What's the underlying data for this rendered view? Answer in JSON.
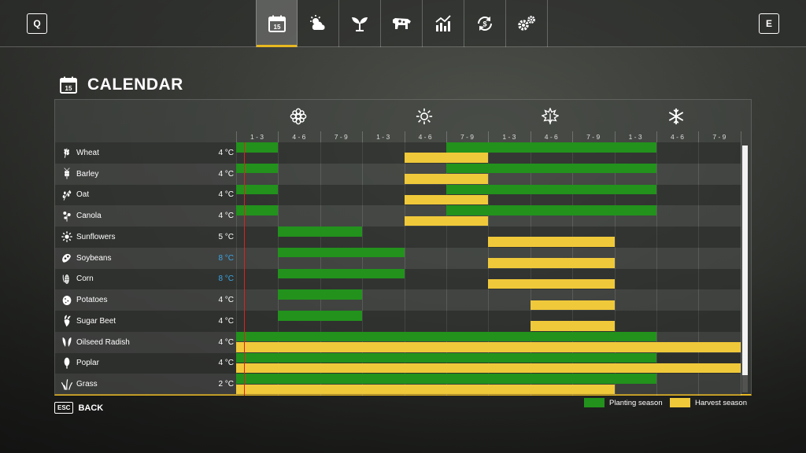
{
  "topbar": {
    "left_key": "Q",
    "right_key": "E",
    "tabs": [
      {
        "icon": "calendar-icon",
        "day": "15",
        "active": true
      },
      {
        "icon": "weather-icon",
        "active": false
      },
      {
        "icon": "sprout-icon",
        "active": false
      },
      {
        "icon": "cow-icon",
        "active": false
      },
      {
        "icon": "prices-chart-icon",
        "active": false
      },
      {
        "icon": "contracts-icon",
        "active": false
      },
      {
        "icon": "settings-gears-icon",
        "active": false
      }
    ]
  },
  "page": {
    "title": "CALENDAR",
    "icon": "calendar-icon",
    "icon_day": "15"
  },
  "seasons": [
    {
      "name": "spring",
      "icon": "flower-icon"
    },
    {
      "name": "summer",
      "icon": "sun-icon"
    },
    {
      "name": "autumn",
      "icon": "leaf-icon"
    },
    {
      "name": "winter",
      "icon": "snowflake-icon"
    }
  ],
  "month_labels": [
    "1 - 3",
    "4 - 6",
    "7 - 9",
    "1 - 3",
    "4 - 6",
    "7 - 9",
    "1 - 3",
    "4 - 6",
    "7 - 9",
    "1 - 3",
    "4 - 6",
    "7 - 9"
  ],
  "crops": [
    {
      "name": "Wheat",
      "temp": "4 °C",
      "warm": false,
      "icon": "wheat-icon",
      "plant": [
        [
          0,
          1
        ],
        [
          5,
          10
        ]
      ],
      "harvest": [
        [
          4,
          6
        ]
      ]
    },
    {
      "name": "Barley",
      "temp": "4 °C",
      "warm": false,
      "icon": "barley-icon",
      "plant": [
        [
          0,
          1
        ],
        [
          5,
          10
        ]
      ],
      "harvest": [
        [
          4,
          6
        ]
      ]
    },
    {
      "name": "Oat",
      "temp": "4 °C",
      "warm": false,
      "icon": "oat-icon",
      "plant": [
        [
          0,
          1
        ],
        [
          5,
          10
        ]
      ],
      "harvest": [
        [
          4,
          6
        ]
      ]
    },
    {
      "name": "Canola",
      "temp": "4 °C",
      "warm": false,
      "icon": "canola-icon",
      "plant": [
        [
          0,
          1
        ],
        [
          5,
          10
        ]
      ],
      "harvest": [
        [
          4,
          6
        ]
      ]
    },
    {
      "name": "Sunflowers",
      "temp": "5 °C",
      "warm": false,
      "icon": "sunflower-icon",
      "plant": [
        [
          1,
          3
        ]
      ],
      "harvest": [
        [
          6,
          9
        ]
      ]
    },
    {
      "name": "Soybeans",
      "temp": "8 °C",
      "warm": true,
      "icon": "soybean-icon",
      "plant": [
        [
          1,
          4
        ]
      ],
      "harvest": [
        [
          6,
          9
        ]
      ]
    },
    {
      "name": "Corn",
      "temp": "8 °C",
      "warm": true,
      "icon": "corn-icon",
      "plant": [
        [
          1,
          4
        ]
      ],
      "harvest": [
        [
          6,
          9
        ]
      ]
    },
    {
      "name": "Potatoes",
      "temp": "4 °C",
      "warm": false,
      "icon": "potato-icon",
      "plant": [
        [
          1,
          3
        ]
      ],
      "harvest": [
        [
          7,
          9
        ]
      ]
    },
    {
      "name": "Sugar Beet",
      "temp": "4 °C",
      "warm": false,
      "icon": "sugar-beet-icon",
      "plant": [
        [
          1,
          3
        ]
      ],
      "harvest": [
        [
          7,
          9
        ]
      ]
    },
    {
      "name": "Oilseed Radish",
      "temp": "4 °C",
      "warm": false,
      "icon": "oilseed-radish-icon",
      "plant": [
        [
          0,
          10
        ]
      ],
      "harvest": [
        [
          0,
          12
        ]
      ]
    },
    {
      "name": "Poplar",
      "temp": "4 °C",
      "warm": false,
      "icon": "poplar-icon",
      "plant": [
        [
          0,
          10
        ]
      ],
      "harvest": [
        [
          0,
          12
        ]
      ]
    },
    {
      "name": "Grass",
      "temp": "2 °C",
      "warm": false,
      "icon": "grass-icon",
      "plant": [
        [
          0,
          10
        ]
      ],
      "harvest": [
        [
          0,
          9
        ]
      ]
    }
  ],
  "today_period_fraction": 0.17,
  "legend": {
    "planting": "Planting season",
    "harvest": "Harvest season",
    "planting_color": "#22921c",
    "harvest_color": "#f0c93a"
  },
  "footer": {
    "esc_key": "ESC",
    "back_label": "BACK"
  }
}
